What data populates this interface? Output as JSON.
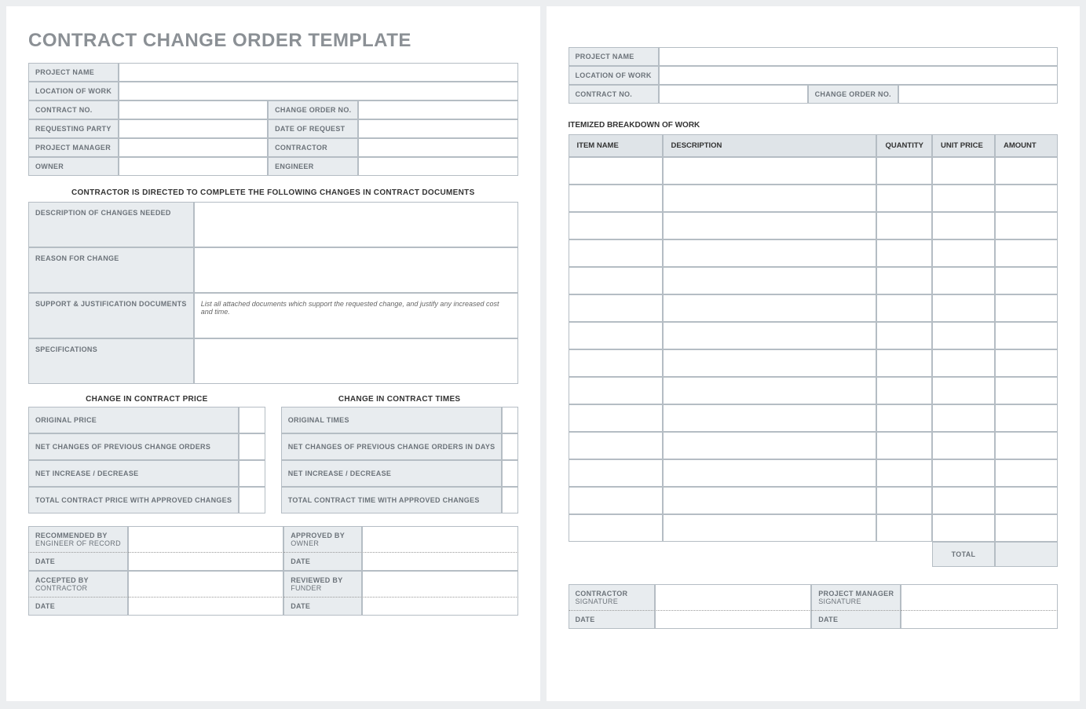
{
  "page1": {
    "title": "CONTRACT CHANGE ORDER TEMPLATE",
    "info": {
      "project_name_lbl": "PROJECT NAME",
      "location_lbl": "LOCATION OF WORK",
      "contract_no_lbl": "CONTRACT NO.",
      "change_order_no_lbl": "CHANGE ORDER NO.",
      "requesting_party_lbl": "REQUESTING PARTY",
      "date_request_lbl": "DATE OF REQUEST",
      "pm_lbl": "PROJECT MANAGER",
      "contractor_lbl": "CONTRACTOR",
      "owner_lbl": "OWNER",
      "engineer_lbl": "ENGINEER"
    },
    "directive": "CONTRACTOR IS DIRECTED TO COMPLETE THE FOLLOWING CHANGES IN CONTRACT DOCUMENTS",
    "changes": {
      "desc_lbl": "DESCRIPTION OF CHANGES NEEDED",
      "reason_lbl": "REASON FOR CHANGE",
      "support_lbl": "SUPPORT & JUSTIFICATION DOCUMENTS",
      "support_hint": "List all attached documents which support the requested change, and justify any increased cost and time.",
      "spec_lbl": "SPECIFICATIONS"
    },
    "price": {
      "header": "CHANGE IN CONTRACT PRICE",
      "orig_lbl": "ORIGINAL PRICE",
      "net_prev_lbl": "NET CHANGES OF PREVIOUS CHANGE ORDERS",
      "net_incdec_lbl": "NET INCREASE / DECREASE",
      "total_lbl": "TOTAL CONTRACT PRICE WITH APPROVED CHANGES"
    },
    "times": {
      "header": "CHANGE IN CONTRACT TIMES",
      "orig_lbl": "ORIGINAL TIMES",
      "net_prev_lbl": "NET CHANGES OF PREVIOUS CHANGE ORDERS IN DAYS",
      "net_incdec_lbl": "NET INCREASE / DECREASE",
      "total_lbl": "TOTAL CONTRACT TIME WITH APPROVED CHANGES"
    },
    "sig": {
      "rec_main": "RECOMMENDED BY",
      "rec_sub": "ENGINEER OF RECORD",
      "app_main": "APPROVED BY",
      "app_sub": "OWNER",
      "acc_main": "ACCEPTED BY",
      "acc_sub": "CONTRACTOR",
      "rev_main": "REVIEWED BY",
      "rev_sub": "FUNDER",
      "date_lbl": "DATE"
    }
  },
  "page2": {
    "info": {
      "project_name_lbl": "PROJECT NAME",
      "location_lbl": "LOCATION OF WORK",
      "contract_no_lbl": "CONTRACT NO.",
      "change_order_no_lbl": "CHANGE ORDER NO."
    },
    "breakdown_header": "ITEMIZED BREAKDOWN OF WORK",
    "cols": {
      "item": "ITEM NAME",
      "desc": "DESCRIPTION",
      "qty": "QUANTITY",
      "unit": "UNIT PRICE",
      "amt": "AMOUNT"
    },
    "rows": 14,
    "total_lbl": "TOTAL",
    "sig": {
      "con_main": "CONTRACTOR",
      "con_sub": "SIGNATURE",
      "pm_main": "PROJECT MANAGER",
      "pm_sub": "SIGNATURE",
      "date_lbl": "DATE"
    }
  }
}
